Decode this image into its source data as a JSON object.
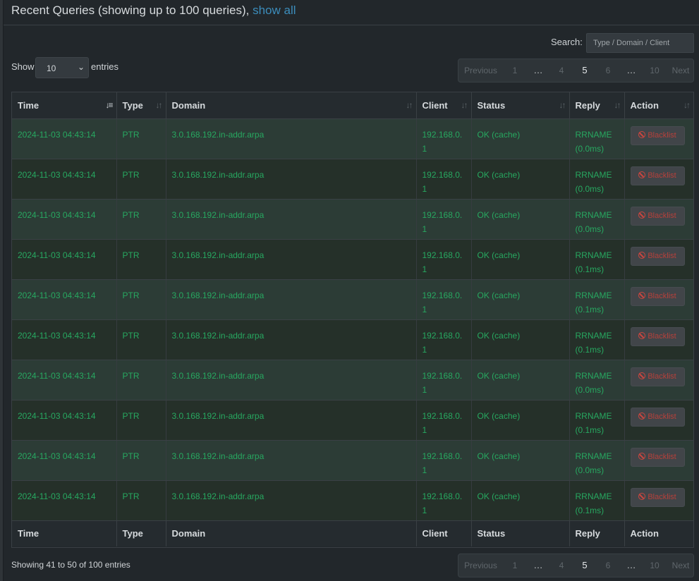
{
  "header": {
    "title": "Recent Queries (showing up to 100 queries), ",
    "show_all_link": "show all"
  },
  "controls": {
    "search_label": "Search:",
    "search_placeholder": "Type / Domain / Client",
    "show_label": "Show",
    "entries_label": "entries",
    "page_length": "10"
  },
  "pagination": {
    "previous": "Previous",
    "next": "Next",
    "ellipsis": "…",
    "pages": [
      "1",
      "4",
      "5",
      "6",
      "10"
    ],
    "current_page": "5"
  },
  "table": {
    "columns": [
      "Time",
      "Type",
      "Domain",
      "Client",
      "Status",
      "Reply",
      "Action"
    ],
    "rows": [
      {
        "time": "2024-11-03 04:43:14",
        "type": "PTR",
        "domain": "3.0.168.192.in-addr.arpa",
        "client": "192.168.0.1",
        "status": "OK (cache)",
        "reply": "RRNAME (0.0ms)",
        "action": "Blacklist"
      },
      {
        "time": "2024-11-03 04:43:14",
        "type": "PTR",
        "domain": "3.0.168.192.in-addr.arpa",
        "client": "192.168.0.1",
        "status": "OK (cache)",
        "reply": "RRNAME (0.0ms)",
        "action": "Blacklist"
      },
      {
        "time": "2024-11-03 04:43:14",
        "type": "PTR",
        "domain": "3.0.168.192.in-addr.arpa",
        "client": "192.168.0.1",
        "status": "OK (cache)",
        "reply": "RRNAME (0.0ms)",
        "action": "Blacklist"
      },
      {
        "time": "2024-11-03 04:43:14",
        "type": "PTR",
        "domain": "3.0.168.192.in-addr.arpa",
        "client": "192.168.0.1",
        "status": "OK (cache)",
        "reply": "RRNAME (0.1ms)",
        "action": "Blacklist"
      },
      {
        "time": "2024-11-03 04:43:14",
        "type": "PTR",
        "domain": "3.0.168.192.in-addr.arpa",
        "client": "192.168.0.1",
        "status": "OK (cache)",
        "reply": "RRNAME (0.1ms)",
        "action": "Blacklist"
      },
      {
        "time": "2024-11-03 04:43:14",
        "type": "PTR",
        "domain": "3.0.168.192.in-addr.arpa",
        "client": "192.168.0.1",
        "status": "OK (cache)",
        "reply": "RRNAME (0.1ms)",
        "action": "Blacklist"
      },
      {
        "time": "2024-11-03 04:43:14",
        "type": "PTR",
        "domain": "3.0.168.192.in-addr.arpa",
        "client": "192.168.0.1",
        "status": "OK (cache)",
        "reply": "RRNAME (0.0ms)",
        "action": "Blacklist"
      },
      {
        "time": "2024-11-03 04:43:14",
        "type": "PTR",
        "domain": "3.0.168.192.in-addr.arpa",
        "client": "192.168.0.1",
        "status": "OK (cache)",
        "reply": "RRNAME (0.1ms)",
        "action": "Blacklist"
      },
      {
        "time": "2024-11-03 04:43:14",
        "type": "PTR",
        "domain": "3.0.168.192.in-addr.arpa",
        "client": "192.168.0.1",
        "status": "OK (cache)",
        "reply": "RRNAME (0.0ms)",
        "action": "Blacklist"
      },
      {
        "time": "2024-11-03 04:43:14",
        "type": "PTR",
        "domain": "3.0.168.192.in-addr.arpa",
        "client": "192.168.0.1",
        "status": "OK (cache)",
        "reply": "RRNAME (0.1ms)",
        "action": "Blacklist"
      }
    ]
  },
  "footer": {
    "info": "Showing 41 to 50 of 100 entries"
  },
  "icons": {
    "sort_active": "sort-desc-icon",
    "sort_inactive": "sort-both-icon",
    "blacklist": "ban-icon"
  },
  "colors": {
    "background": "#22272b",
    "status_ok_text": "#27a860",
    "row_odd": "#2c3c36",
    "row_even": "#253029",
    "link": "#3c8dbc",
    "blacklist_text": "#b8403a"
  }
}
